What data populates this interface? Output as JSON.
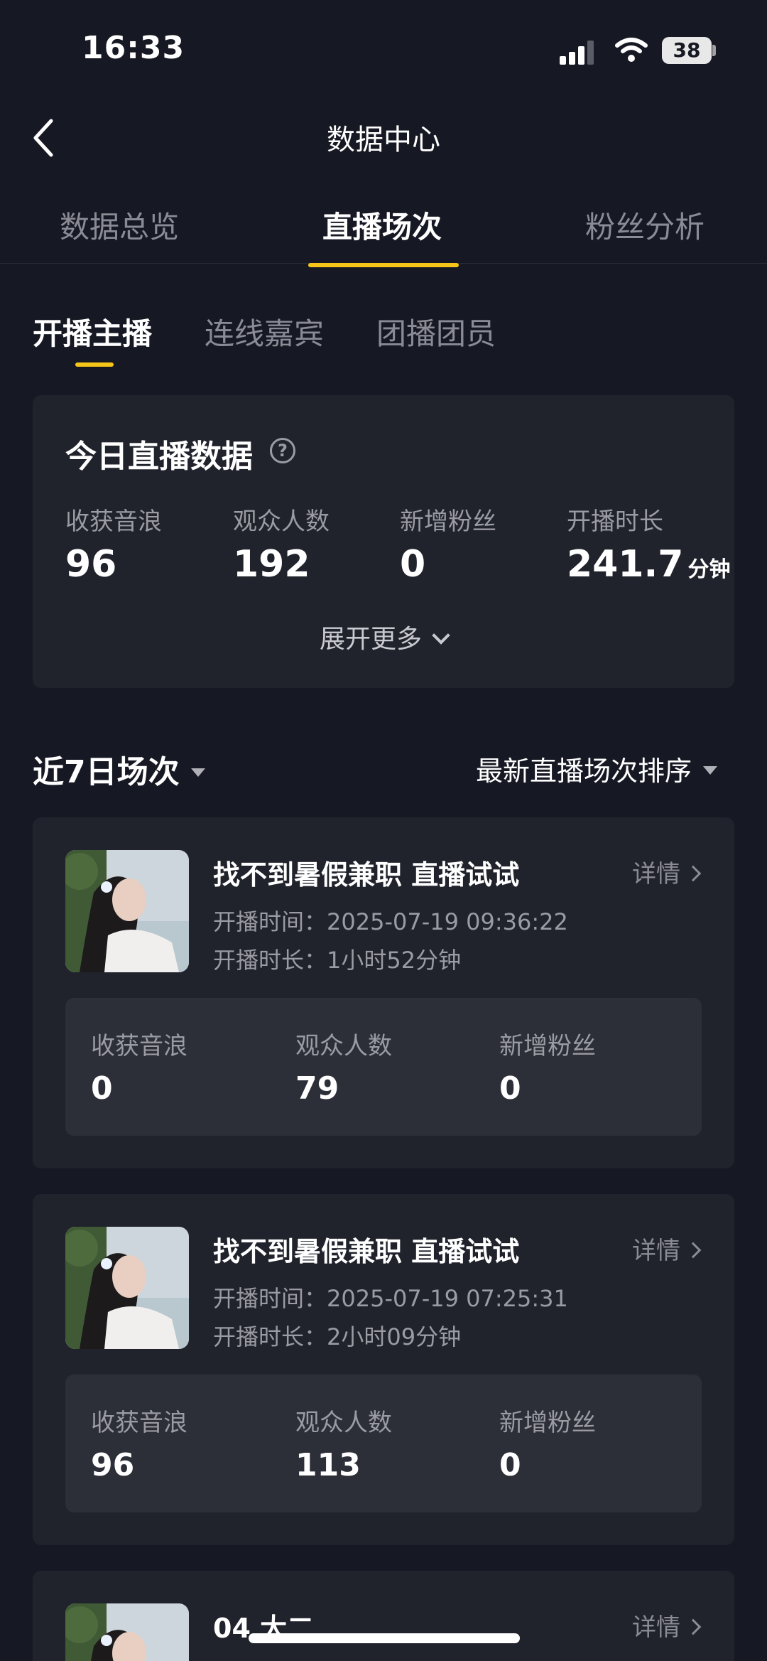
{
  "status": {
    "time": "16:33",
    "battery": "38"
  },
  "header": {
    "title": "数据中心"
  },
  "tabs": [
    {
      "label": "数据总览"
    },
    {
      "label": "直播场次"
    },
    {
      "label": "粉丝分析"
    }
  ],
  "subtabs": [
    {
      "label": "开播主播"
    },
    {
      "label": "连线嘉宾"
    },
    {
      "label": "团播团员"
    }
  ],
  "today": {
    "title": "今日直播数据",
    "help": "?",
    "stats": [
      {
        "label": "收获音浪",
        "value": "96"
      },
      {
        "label": "观众人数",
        "value": "192"
      },
      {
        "label": "新增粉丝",
        "value": "0"
      },
      {
        "label": "开播时长",
        "value": "241.7",
        "unit": "分钟"
      }
    ],
    "expand": "展开更多"
  },
  "sessions_header": {
    "range": "近7日场次",
    "sort": "最新直播场次排序"
  },
  "sessions": [
    {
      "title": "找不到暑假兼职 直播试试",
      "start": "开播时间：2025-07-19 09:36:22",
      "duration": "开播时长：1小时52分钟",
      "detail": "详情",
      "stats": [
        {
          "label": "收获音浪",
          "value": "0"
        },
        {
          "label": "观众人数",
          "value": "79"
        },
        {
          "label": "新增粉丝",
          "value": "0"
        }
      ]
    },
    {
      "title": "找不到暑假兼职 直播试试",
      "start": "开播时间：2025-07-19 07:25:31",
      "duration": "开播时长：2小时09分钟",
      "detail": "详情",
      "stats": [
        {
          "label": "收获音浪",
          "value": "96"
        },
        {
          "label": "观众人数",
          "value": "113"
        },
        {
          "label": "新增粉丝",
          "value": "0"
        }
      ]
    },
    {
      "title": "04 大二",
      "detail": "详情"
    }
  ]
}
